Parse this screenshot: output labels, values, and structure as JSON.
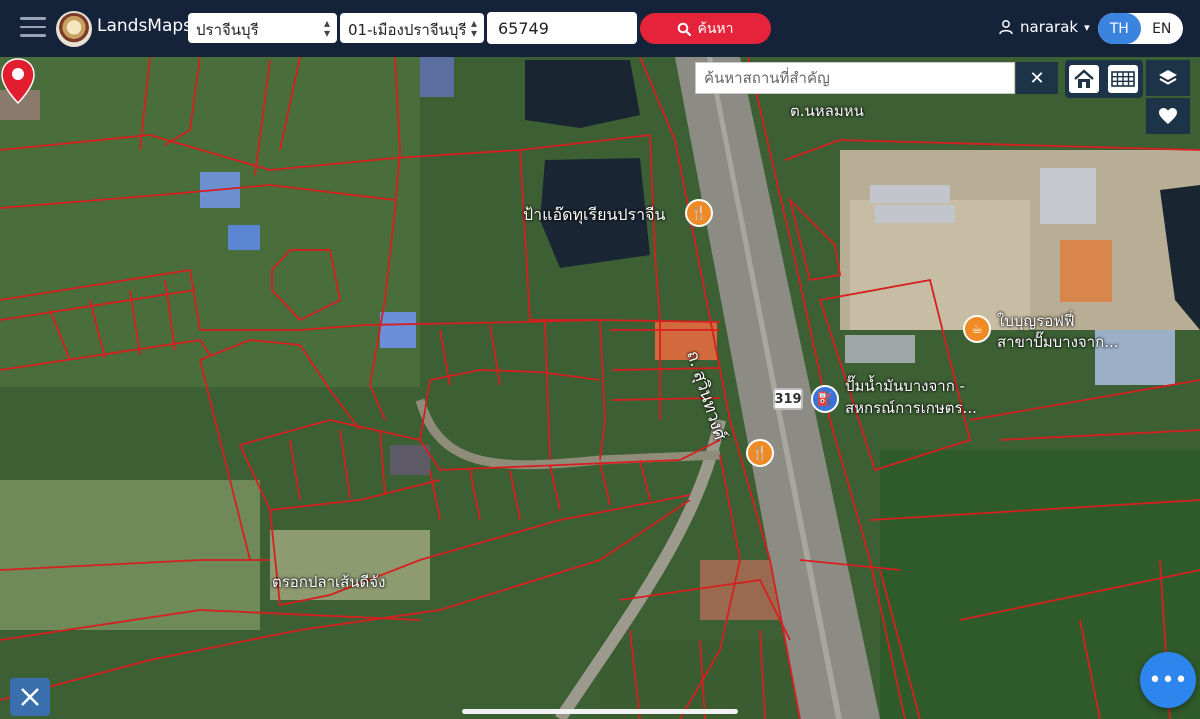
{
  "header": {
    "app_name": "LandsMaps",
    "province": "ปราจีนบุรี",
    "district": "01-เมืองปราจีนบุรี",
    "parcel_number": "65749",
    "search_label": "ค้นหา",
    "username": "nararak",
    "lang_th": "TH",
    "lang_en": "EN",
    "active_lang": "TH"
  },
  "map_tools": {
    "place_search_placeholder": "ค้นหาสถานที่สำคัญ",
    "clear_icon": "close-icon",
    "home_icon": "home-icon",
    "grid_icon": "grid-icon",
    "layers_icon": "layers-icon",
    "favorite_icon": "heart-icon",
    "more_icon": "ellipsis-icon",
    "measure_icon": "ruler-pencil-icon"
  },
  "map": {
    "labels": {
      "durian_shop": "ป้าแอ๊ดทุเรียนปราจีน",
      "road_name": "ถ. สุวินทวงศ์",
      "route_number": "319",
      "cafe_line1": "ใบบุญรอฟฟี่",
      "cafe_line2": "สาขาปั๊มบางจาก...",
      "gas_line1": "ปั๊มน้ำมันบางจาก -",
      "gas_line2": "สหกรณ์การเกษตร...",
      "top_label": "ต.นหลมหน",
      "marker_label": "ตรอกปลาเส้นดีจัง"
    },
    "colors": {
      "parcel_line": "#d61f1f",
      "header_bg": "#14223a",
      "accent_red": "#e5243b",
      "accent_blue": "#2c86ee"
    }
  }
}
